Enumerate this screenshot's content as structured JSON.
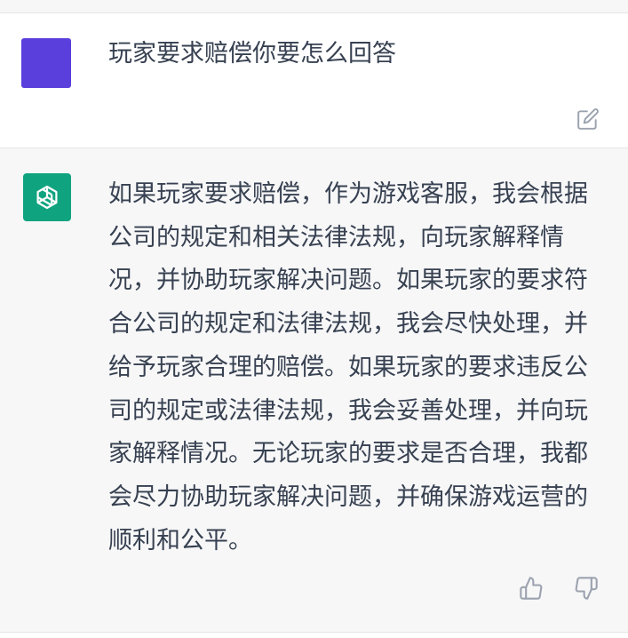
{
  "conversation": {
    "user_message": {
      "text": "玩家要求赔偿你要怎么回答",
      "avatar_color": "#5a3fdc",
      "edit_icon": "edit-icon"
    },
    "assistant_message": {
      "text": "如果玩家要求赔偿，作为游戏客服，我会根据公司的规定和相关法律法规，向玩家解释情况，并协助玩家解决问题。如果玩家的要求符合公司的规定和法律法规，我会尽快处理，并给予玩家合理的赔偿。如果玩家的要求违反公司的规定或法律法规，我会妥善处理，并向玩家解释情况。无论玩家的要求是否合理，我都会尽力协助玩家解决问题，并确保游戏运营的顺利和公平。",
      "avatar_color": "#10a37f",
      "avatar_icon": "openai-logo-icon",
      "feedback_icons": [
        "thumbs-up-icon",
        "thumbs-down-icon"
      ]
    }
  }
}
